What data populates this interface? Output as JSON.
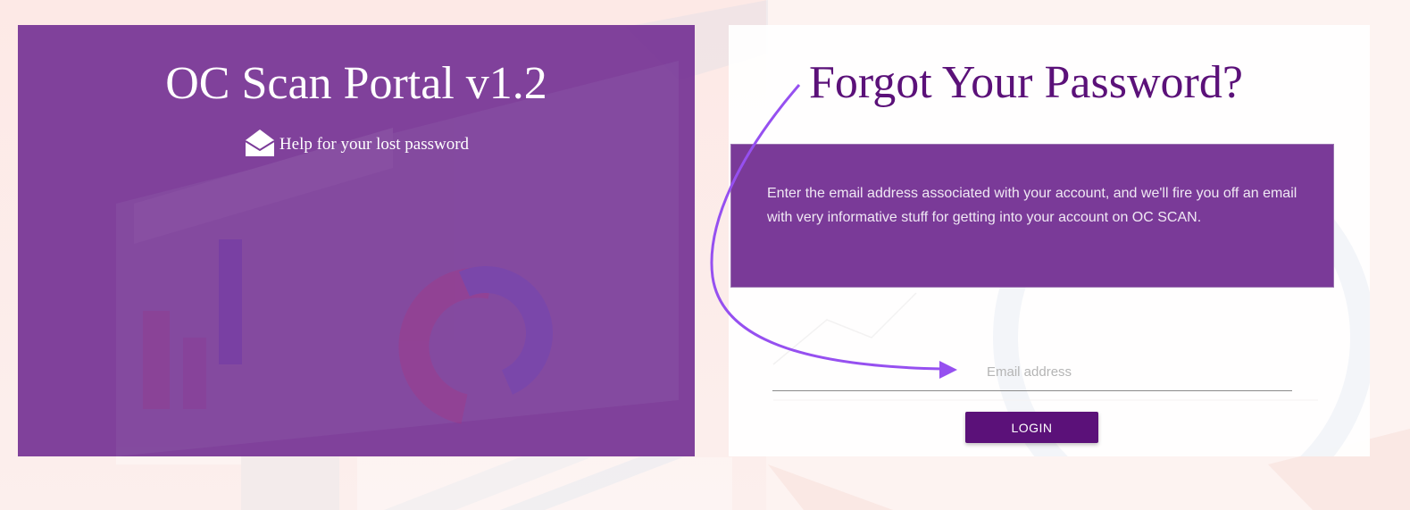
{
  "left_panel": {
    "title": "OC Scan Portal v1.2",
    "help_icon": "envelope-open-icon",
    "help_text": "Help for your lost password"
  },
  "right_card": {
    "title": "Forgot Your Password?",
    "info_text": "Enter the email address associated with your account, and we'll fire you off an email with very informative stuff for getting into your account on OC SCAN.",
    "email_placeholder": "Email address",
    "email_value": "",
    "login_label": "LOGIN"
  },
  "colors": {
    "panel_purple": "#763494",
    "title_purple": "#5b1179",
    "button_purple": "#5b1179",
    "arrow_purple": "#9650f0"
  }
}
